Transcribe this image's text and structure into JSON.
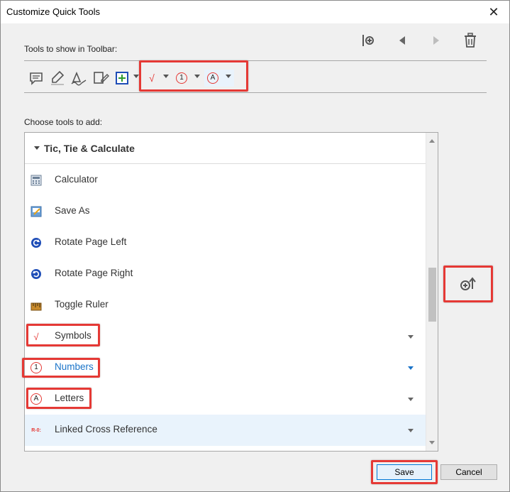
{
  "window": {
    "title": "Customize Quick Tools",
    "close_glyph": "✕"
  },
  "toolbar_label": "Tools to show in Toolbar:",
  "top_actions": [
    {
      "name": "insert-separator-icon"
    },
    {
      "name": "move-left-icon"
    },
    {
      "name": "move-right-icon"
    },
    {
      "name": "trash-icon"
    }
  ],
  "toolbar_tools": [
    {
      "name": "comment-icon"
    },
    {
      "name": "highlight-icon"
    },
    {
      "name": "sign-icon"
    },
    {
      "name": "fill-sign-icon"
    },
    {
      "name": "add-image-icon"
    },
    {
      "name": "symbol-check-icon",
      "glyph": "√"
    },
    {
      "name": "numbered-circle-icon",
      "glyph": "1"
    },
    {
      "name": "lettered-circle-icon",
      "glyph": "A"
    }
  ],
  "choose_label": "Choose tools to add:",
  "group": {
    "title": "Tic, Tie & Calculate"
  },
  "tools": [
    {
      "label": "Calculator"
    },
    {
      "label": "Save As"
    },
    {
      "label": "Rotate Page Left"
    },
    {
      "label": "Rotate Page Right"
    },
    {
      "label": "Toggle Ruler"
    },
    {
      "label": "Symbols",
      "glyph": "√"
    },
    {
      "label": "Numbers",
      "glyph": "1"
    },
    {
      "label": "Letters",
      "glyph": "A"
    },
    {
      "label": "Linked Cross Reference",
      "glyph": "R-0:"
    }
  ],
  "buttons": {
    "save": "Save",
    "cancel": "Cancel"
  },
  "colors": {
    "highlight": "#e53935",
    "link": "#1a73c8",
    "selection": "#e9f3fc"
  }
}
